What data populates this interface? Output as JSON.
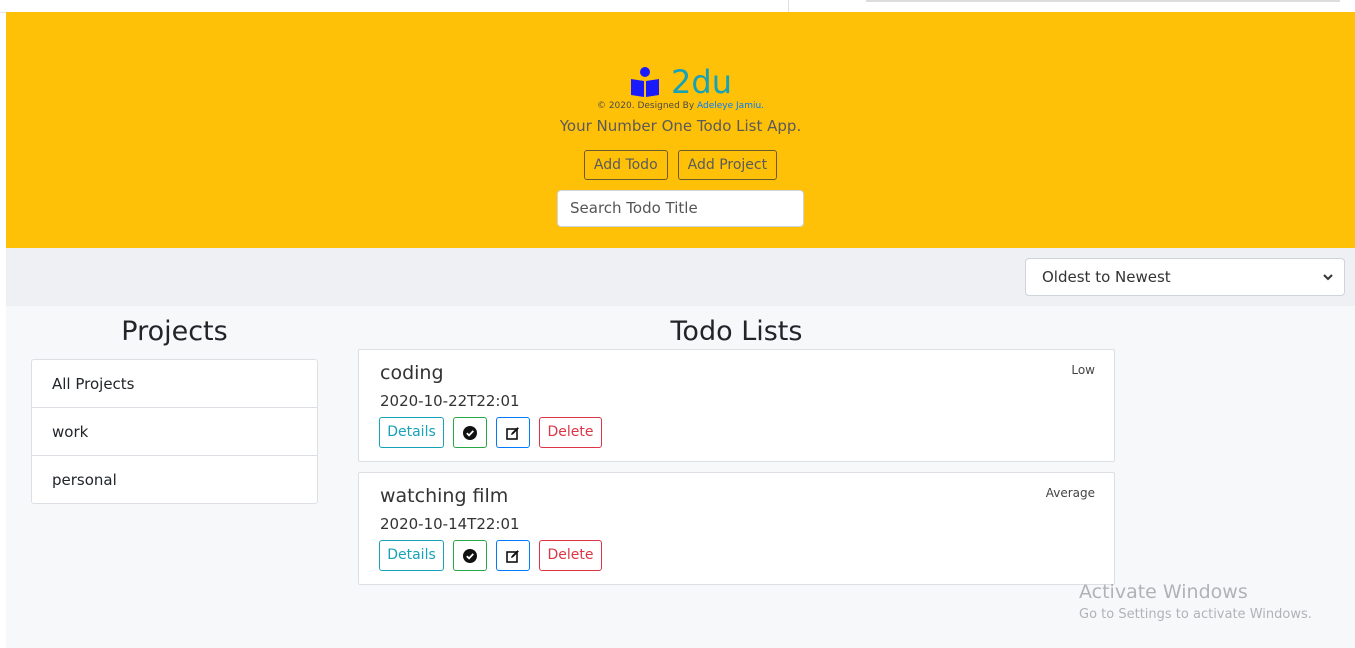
{
  "header": {
    "app_name": "2du",
    "credit_prefix": "© 2020. Designed By",
    "credit_author": "Adeleye Jamiu.",
    "tagline": "Your Number One Todo List App.",
    "add_todo_label": "Add Todo",
    "add_project_label": "Add Project",
    "search_placeholder": "Search Todo Title",
    "background_color": "#ffc107",
    "accent_color": "#17a2b8"
  },
  "sort": {
    "selected": "Oldest to Newest"
  },
  "projects": {
    "title": "Projects",
    "items": [
      {
        "label": "All Projects"
      },
      {
        "label": "work"
      },
      {
        "label": "personal"
      }
    ]
  },
  "todos": {
    "title": "Todo Lists",
    "details_label": "Details",
    "delete_label": "Delete",
    "items": [
      {
        "title": "coding",
        "date": "2020-10-22T22:01",
        "priority": "Low"
      },
      {
        "title": "watching film",
        "date": "2020-10-14T22:01",
        "priority": "Average"
      }
    ]
  },
  "watermark": {
    "title": "Activate Windows",
    "subtitle": "Go to Settings to activate Windows."
  },
  "icons": {
    "logo": "reader-icon",
    "done": "check-circle-icon",
    "edit": "edit-icon",
    "sort": "chevron-down-icon"
  }
}
